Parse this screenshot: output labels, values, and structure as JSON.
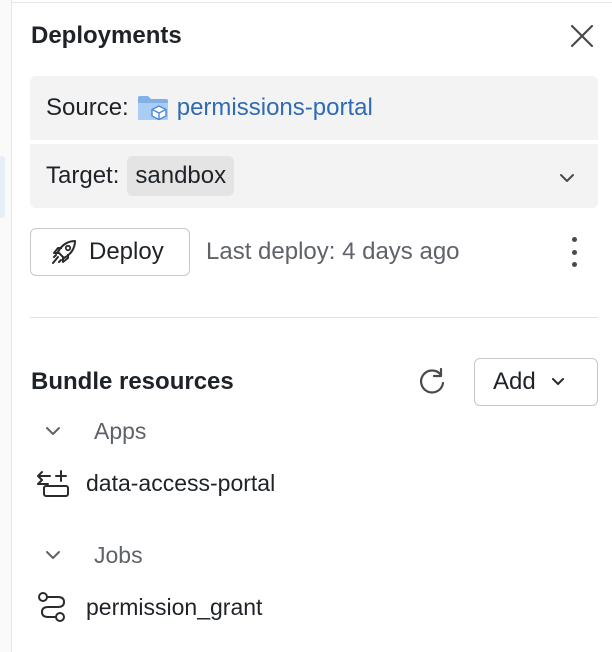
{
  "panel": {
    "title": "Deployments"
  },
  "source": {
    "label": "Source:",
    "value": "permissions-portal",
    "icon": "folder-bundle-icon"
  },
  "target": {
    "label": "Target:",
    "value": "sandbox"
  },
  "deploy": {
    "button_label": "Deploy",
    "last_deploy": "Last deploy: 4 days ago"
  },
  "bundle_resources": {
    "title": "Bundle resources",
    "add_label": "Add",
    "groups": [
      {
        "name": "Apps",
        "items": [
          {
            "label": "data-access-portal",
            "icon": "app-icon"
          }
        ]
      },
      {
        "name": "Jobs",
        "items": [
          {
            "label": "permission_grant",
            "icon": "job-icon"
          }
        ]
      }
    ]
  },
  "colors": {
    "link": "#2f6bb3",
    "muted": "#5f6368",
    "box_bg": "#f3f3f3"
  }
}
